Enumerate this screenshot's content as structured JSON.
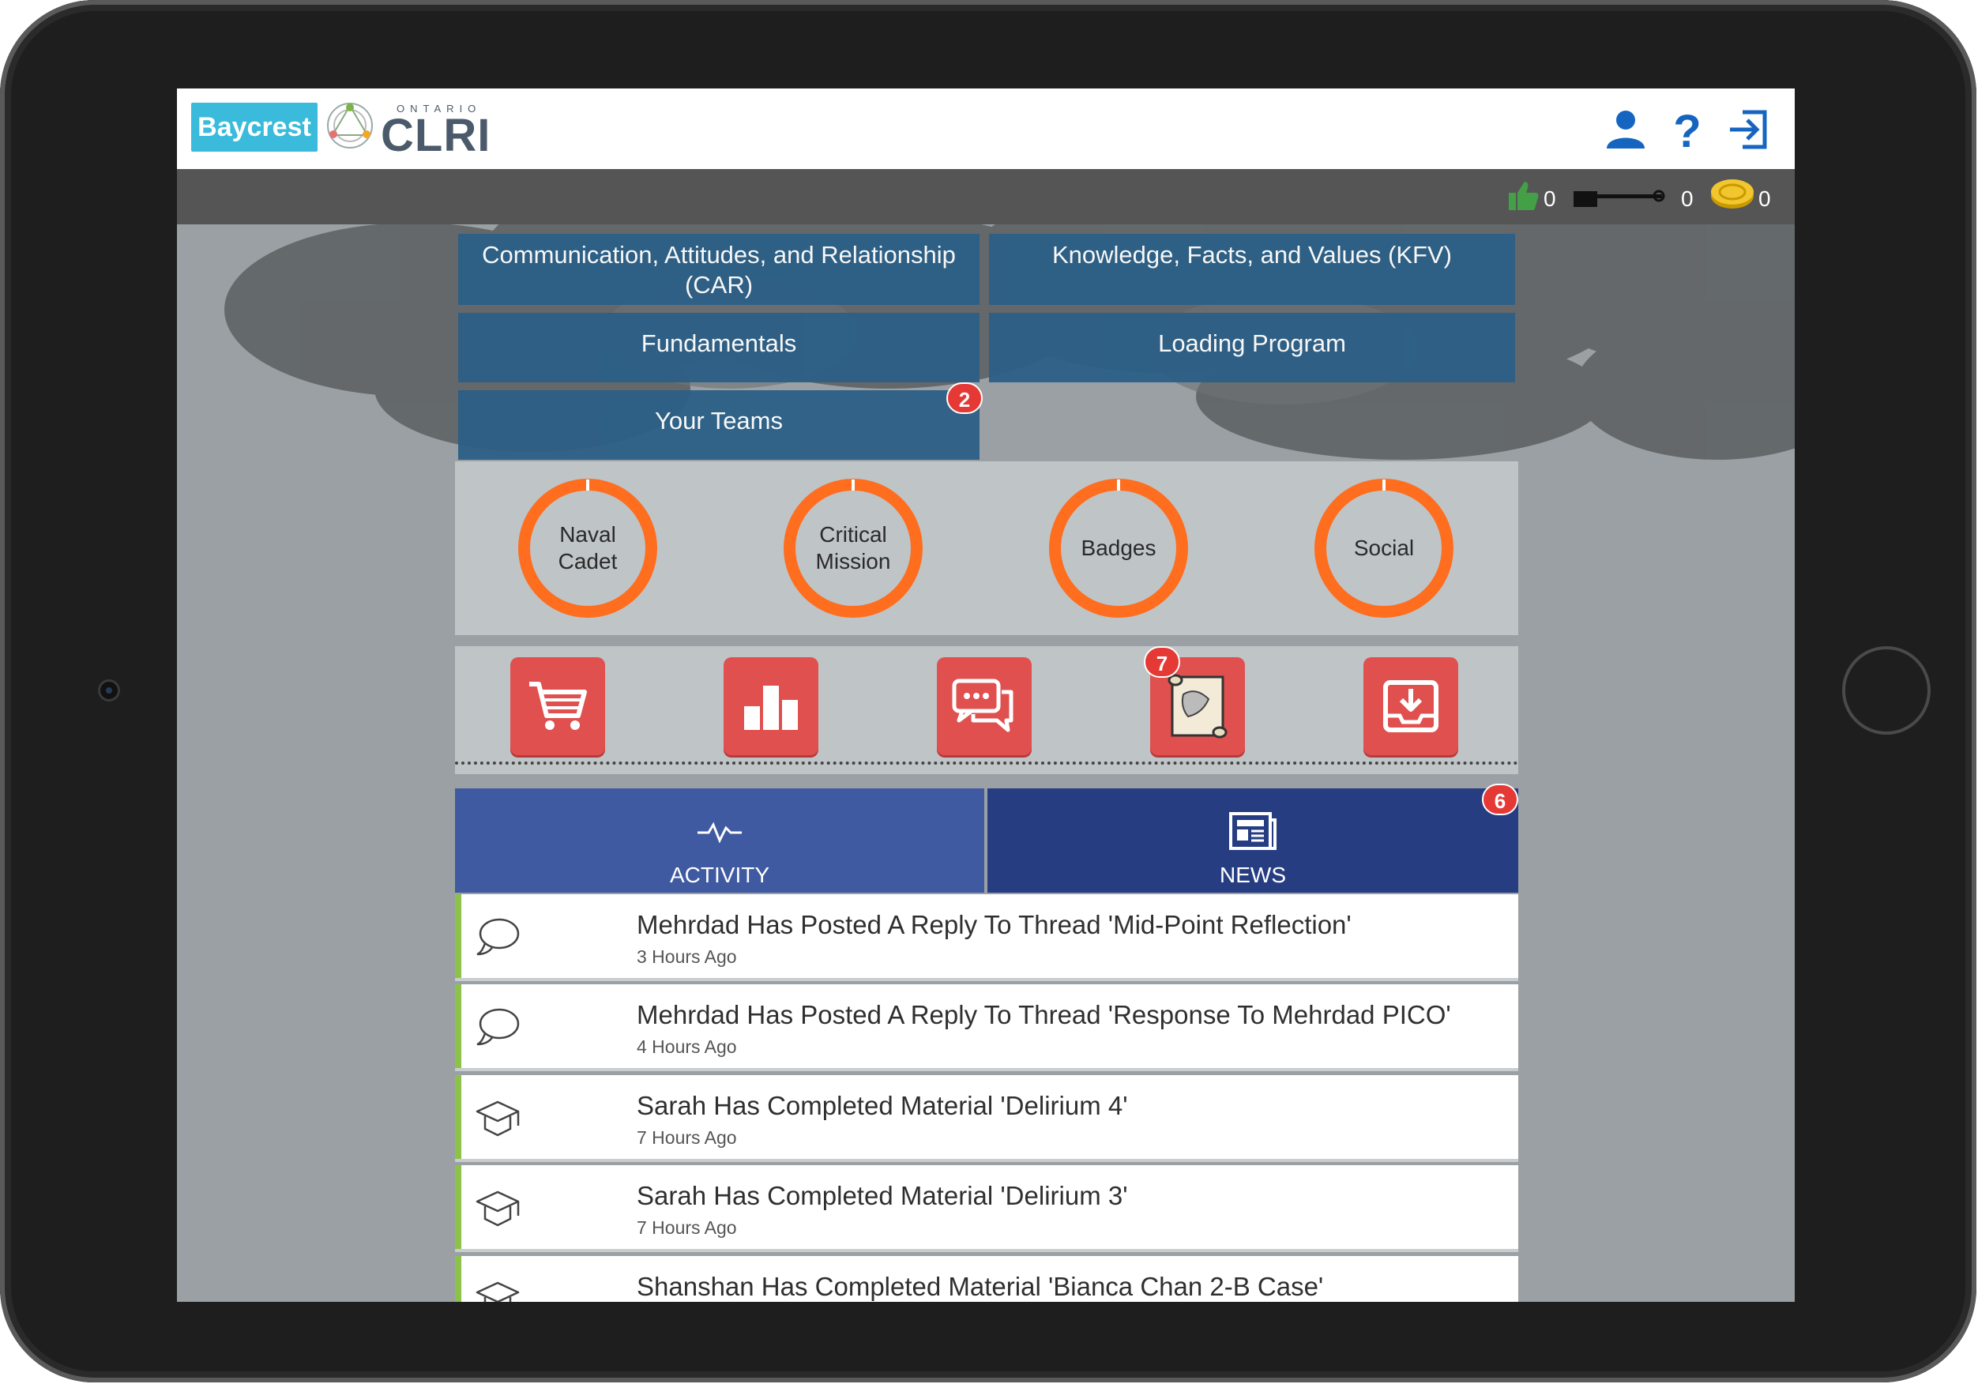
{
  "header": {
    "logo_primary": "Baycrest",
    "logo_secondary_small": "ONTARIO",
    "logo_secondary_big": "CLRI",
    "icons": [
      "user-icon",
      "help-icon",
      "logout-icon"
    ]
  },
  "stats": {
    "likes": "0",
    "keys": "0",
    "coins": "0"
  },
  "categories": [
    {
      "label": "Communication, Attitudes, and Relationship (CAR)"
    },
    {
      "label": "Knowledge, Facts, and Values (KFV)"
    },
    {
      "label": "Fundamentals"
    },
    {
      "label": "Loading Program"
    },
    {
      "label": "Your Teams",
      "badge": "2"
    }
  ],
  "rings": [
    {
      "label": "Naval Cadet"
    },
    {
      "label": "Critical Mission"
    },
    {
      "label": "Badges"
    },
    {
      "label": "Social"
    }
  ],
  "tools": [
    {
      "icon": "cart-icon"
    },
    {
      "icon": "bar-chart-icon"
    },
    {
      "icon": "chat-icon"
    },
    {
      "icon": "map-scroll-icon",
      "badge": "7"
    },
    {
      "icon": "download-icon"
    }
  ],
  "tabs": [
    {
      "label": "ACTIVITY",
      "icon": "activity-icon"
    },
    {
      "label": "NEWS",
      "icon": "news-icon",
      "badge": "6"
    }
  ],
  "feed": [
    {
      "icon": "comment-icon",
      "title": "Mehrdad Has Posted A Reply To Thread 'Mid-Point Reflection'",
      "time": "3 Hours Ago"
    },
    {
      "icon": "comment-icon",
      "title": "Mehrdad Has Posted A Reply To Thread 'Response To Mehrdad PICO'",
      "time": "4 Hours Ago"
    },
    {
      "icon": "graduation-cap-icon",
      "title": "Sarah Has Completed Material 'Delirium 4'",
      "time": "7 Hours Ago"
    },
    {
      "icon": "graduation-cap-icon",
      "title": "Sarah Has Completed Material 'Delirium 3'",
      "time": "7 Hours Ago"
    },
    {
      "icon": "graduation-cap-icon",
      "title": "Shanshan Has Completed Material 'Bianca Chan 2-B Case'",
      "time": ""
    }
  ],
  "colors": {
    "category_bg": "#2c5f86",
    "ring": "#ff6d1f",
    "tool_bg": "#e0504f",
    "tab_activity": "#3f5aa0",
    "tab_news": "#263d82",
    "badge": "#e53935",
    "feed_accent": "#8bc34a",
    "baycrest": "#3bbbdb"
  }
}
